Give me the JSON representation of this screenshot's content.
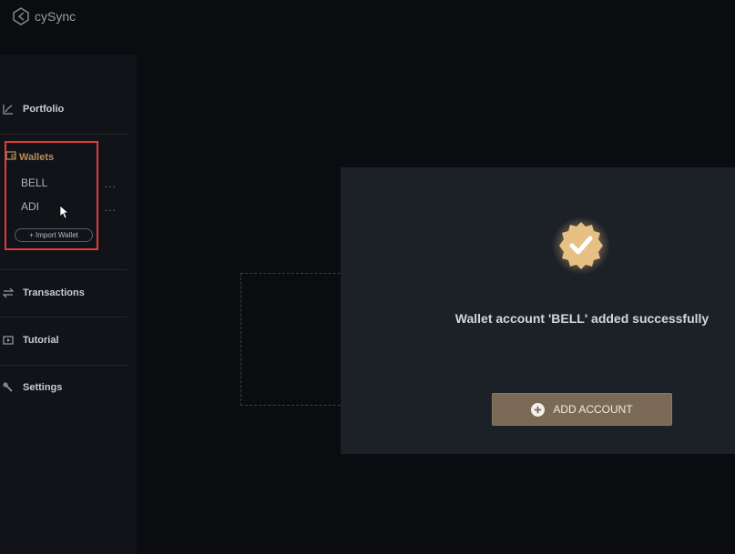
{
  "app": {
    "title": "cySync"
  },
  "sidebar": {
    "portfolio": "Portfolio",
    "wallets": "Wallets",
    "wallet_list": [
      "BELL",
      "ADI"
    ],
    "more_glyph": "...",
    "import_wallet": "+ Import Wallet",
    "transactions": "Transactions",
    "tutorial": "Tutorial",
    "settings": "Settings"
  },
  "modal": {
    "message": "Wallet account 'BELL' added successfully",
    "add_account": "ADD ACCOUNT"
  },
  "colors": {
    "accent": "#b98f55",
    "highlight_box": "#e53a3a",
    "modal_bg": "#1c2027",
    "button_bg": "#7a6a55",
    "badge": "#e7c083"
  }
}
